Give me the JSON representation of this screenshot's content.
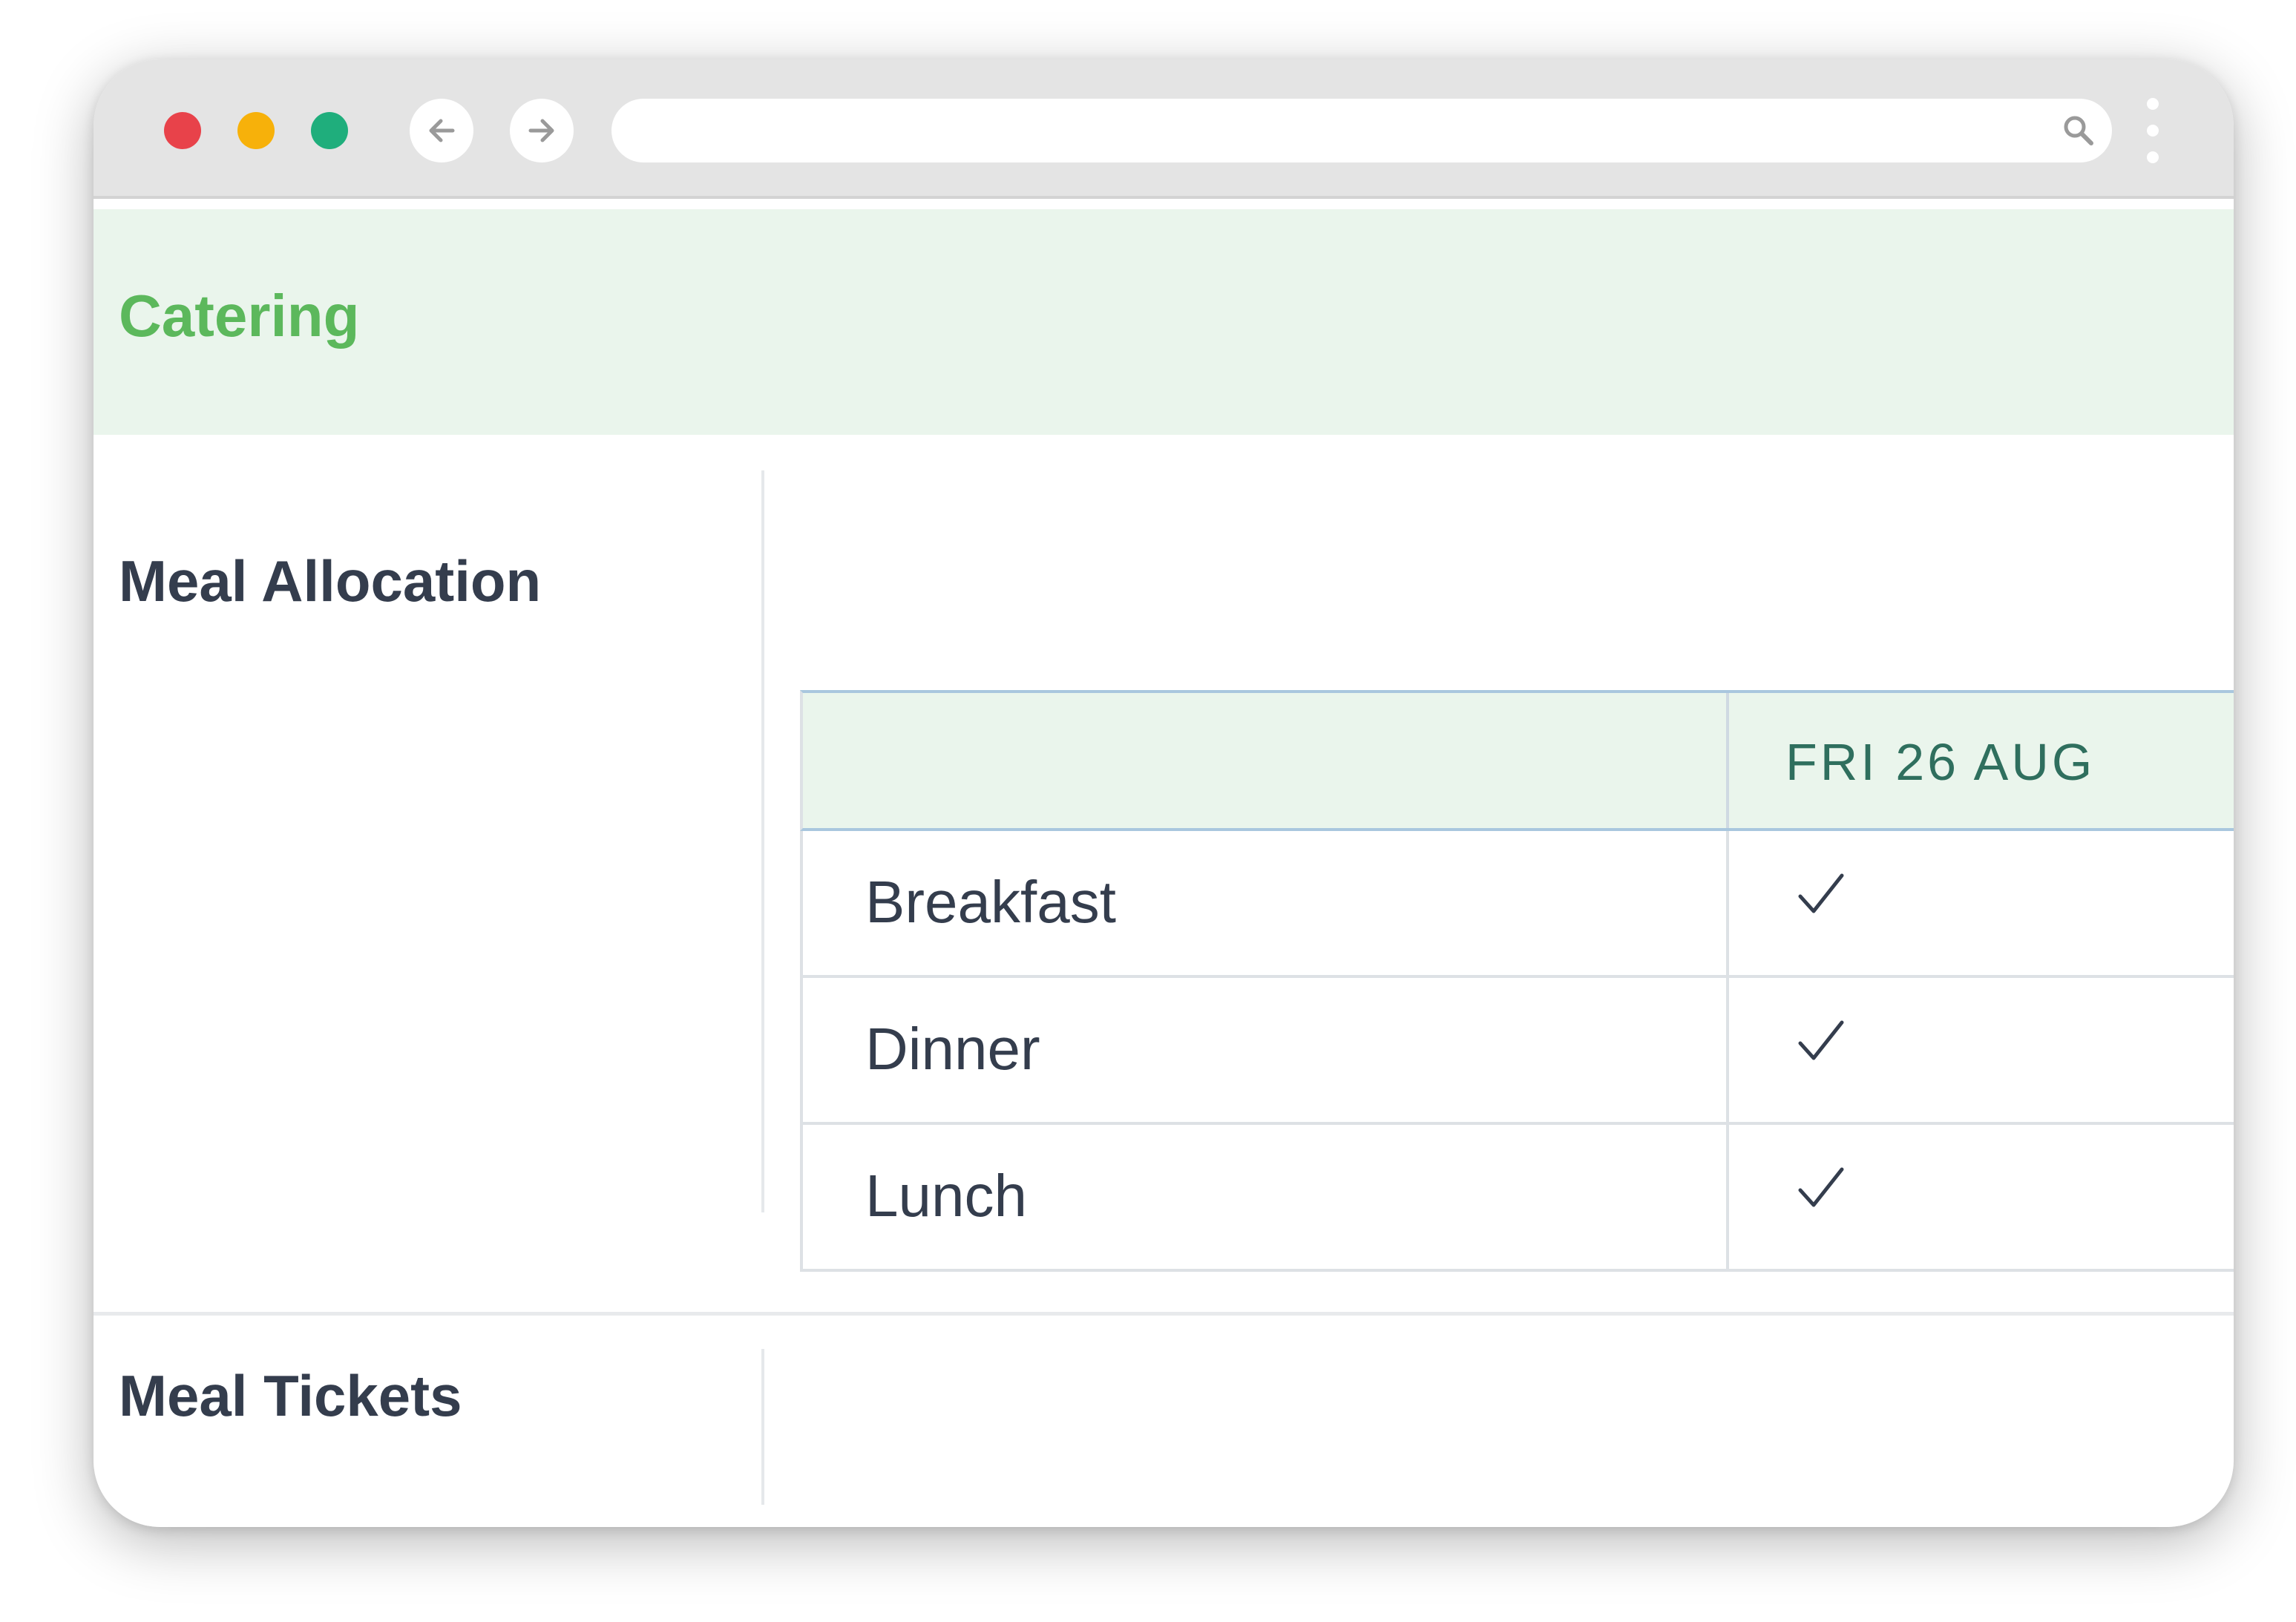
{
  "browser": {
    "traffic_lights": {
      "close_color": "#e8424a",
      "minimize_color": "#f7b10a",
      "maximize_color": "#1fae7c"
    },
    "back_icon": "arrow-left-icon",
    "forward_icon": "arrow-right-icon",
    "address_bar_value": "",
    "search_icon": "search-icon",
    "menu_icon": "kebab-menu-icon"
  },
  "page": {
    "banner_title": "Catering",
    "banner_color": "#eaf5ec",
    "banner_text_color": "#5cb85c",
    "sections": {
      "meal_allocation": {
        "label": "Meal Allocation",
        "table": {
          "header": [
            "",
            "FRI 26 AUG"
          ],
          "rows": [
            {
              "meal": "Breakfast",
              "fri_26_aug": true
            },
            {
              "meal": "Dinner",
              "fri_26_aug": true
            },
            {
              "meal": "Lunch",
              "fri_26_aug": true
            }
          ]
        }
      },
      "meal_tickets": {
        "label": "Meal Tickets"
      }
    }
  }
}
